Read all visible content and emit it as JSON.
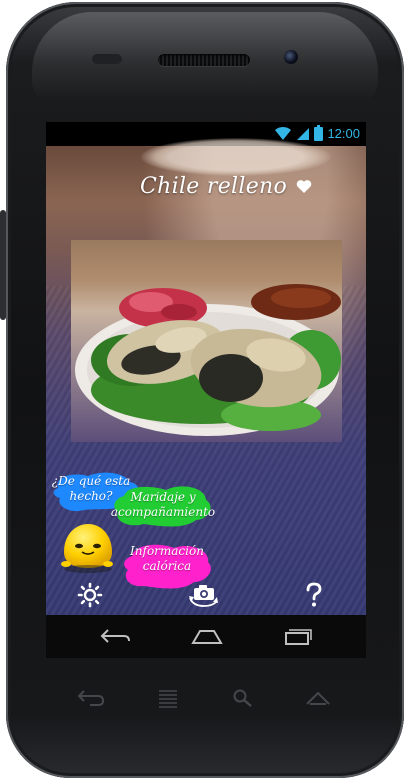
{
  "status_bar": {
    "time": "12:00",
    "icons": [
      "wifi-icon",
      "signal-icon",
      "battery-icon"
    ],
    "accent_color": "#33b5e5"
  },
  "app": {
    "title": "Chile relleno",
    "favorite_icon": "heart-icon",
    "photo_icon": "dish-photo",
    "options": [
      {
        "label": "¿De qué esta hecho?",
        "color": "#1e88ff"
      },
      {
        "label": "Maridaje y acompañamiento",
        "color": "#22cc33"
      },
      {
        "label": "Información calórica",
        "color": "#ff22cc"
      }
    ],
    "mascot_icon": "smiley-face-icon",
    "bottom_icons": [
      "settings-icon",
      "camera-switch-icon",
      "help-icon"
    ]
  },
  "nav_bar": {
    "icons": [
      "back-icon",
      "home-icon",
      "recent-apps-icon"
    ]
  },
  "hardware_keys": {
    "icons": [
      "back-key-icon",
      "menu-key-icon",
      "search-key-icon",
      "home-key-icon"
    ]
  }
}
